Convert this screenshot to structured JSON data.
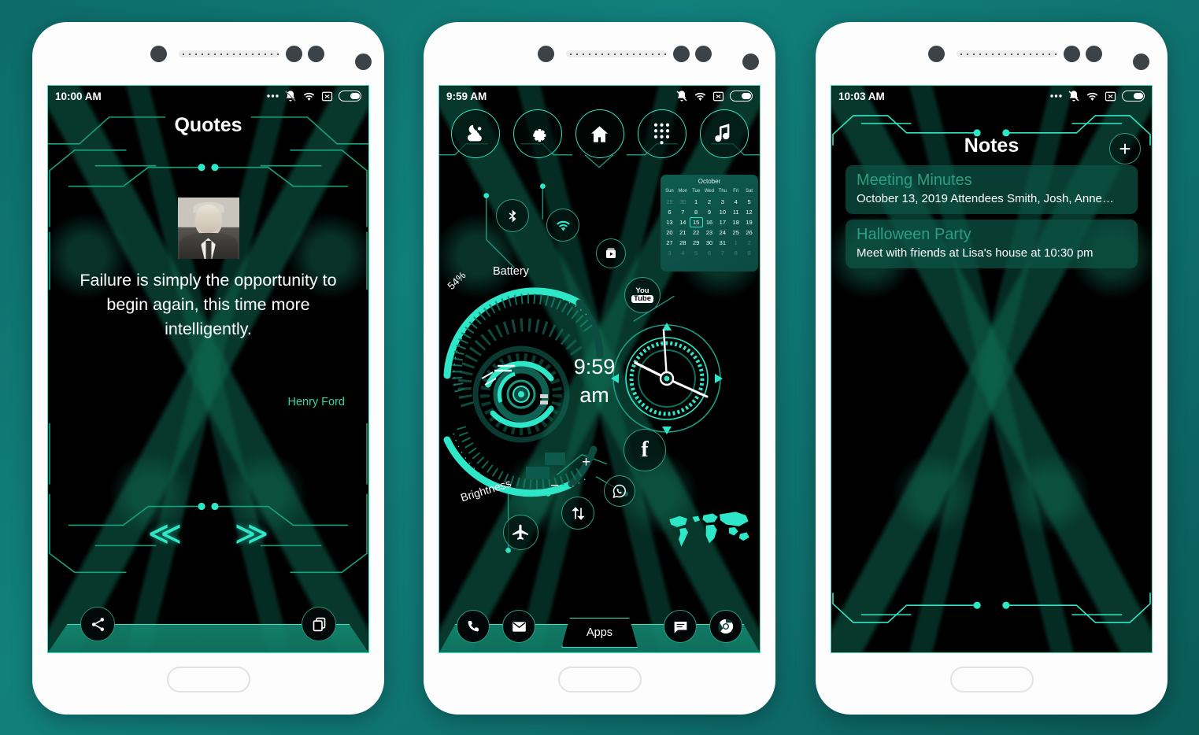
{
  "theme": {
    "page_background": "#0e7370",
    "accent_cyan": "#2ee6c8",
    "accent_green": "#2fd6a8",
    "screen_background": "#000000",
    "note_card_background": "#0c5448",
    "dock_green": "#148e76"
  },
  "phones": [
    {
      "id": "quotes",
      "status_bar": {
        "time": "10:00 AM",
        "icons": [
          "more-dots-icon",
          "bell-muted-icon",
          "wifi-icon",
          "no-sim-icon",
          "battery-icon"
        ]
      },
      "screen": {
        "title": "Quotes",
        "portrait_alt": "Henry Ford portrait",
        "quote_text": "Failure is simply the opportunity to begin again, this time more intelligently.",
        "author": "Henry Ford",
        "prev_label": "≪",
        "next_label": "≫",
        "share_icon": "share-icon",
        "copy_icon": "copy-icon"
      }
    },
    {
      "id": "home",
      "status_bar": {
        "time": "9:59 AM",
        "icons": [
          "bell-muted-icon",
          "wifi-icon",
          "no-sim-icon",
          "battery-icon"
        ]
      },
      "screen": {
        "top_icons": [
          {
            "name": "weather-icon",
            "label": "Weather"
          },
          {
            "name": "settings-gear-icon",
            "label": "Settings"
          },
          {
            "name": "home-icon",
            "label": "Home"
          },
          {
            "name": "dialpad-icon",
            "label": "Dialpad"
          },
          {
            "name": "music-note-icon",
            "label": "Music"
          }
        ],
        "calendar": {
          "month": "October",
          "day_headers": [
            "Sun",
            "Mon",
            "Tue",
            "Wed",
            "Thu",
            "Fri",
            "Sat"
          ],
          "weeks": [
            [
              "29",
              "30",
              "1",
              "2",
              "3",
              "4",
              "5"
            ],
            [
              "6",
              "7",
              "8",
              "9",
              "10",
              "11",
              "12"
            ],
            [
              "13",
              "14",
              "15",
              "16",
              "17",
              "18",
              "19"
            ],
            [
              "20",
              "21",
              "22",
              "23",
              "24",
              "25",
              "26"
            ],
            [
              "27",
              "28",
              "29",
              "30",
              "31",
              "1",
              "2"
            ],
            [
              "3",
              "4",
              "5",
              "6",
              "7",
              "8",
              "9"
            ]
          ],
          "today": "15",
          "leading_muted": 2,
          "trailing_muted_from": "2019-11-01"
        },
        "toggles": [
          {
            "name": "bluetooth-toggle",
            "state": "off"
          },
          {
            "name": "wifi-toggle",
            "state": "on"
          },
          {
            "name": "airplane-mode-toggle",
            "state": "off"
          },
          {
            "name": "data-sync-toggle",
            "state": "off"
          }
        ],
        "battery_gauge": {
          "label": "Battery",
          "value": "54%",
          "percent": 54
        },
        "brightness_gauge": {
          "label": "Brightness",
          "increase": "+",
          "decrease": "−",
          "percent": 64
        },
        "digital_clock": {
          "time": "9:59",
          "meridiem": "am"
        },
        "analog_clock": {
          "hour": 9,
          "minute": 59
        },
        "shortcuts": [
          {
            "name": "play-store-icon",
            "label": "Play Store"
          },
          {
            "name": "youtube-icon",
            "label_top": "You",
            "label_bottom": "Tube"
          },
          {
            "name": "facebook-icon",
            "label": "f"
          },
          {
            "name": "whatsapp-icon",
            "label": "WhatsApp"
          }
        ],
        "world_map_label": "World map",
        "dock": [
          {
            "name": "dock-phone",
            "icon": "phone-icon"
          },
          {
            "name": "dock-mail",
            "icon": "envelope-icon"
          },
          {
            "name": "dock-apps",
            "label": "Apps"
          },
          {
            "name": "dock-messages",
            "icon": "message-icon"
          },
          {
            "name": "dock-chrome",
            "icon": "chrome-icon"
          }
        ]
      }
    },
    {
      "id": "notes",
      "status_bar": {
        "time": "10:03 AM",
        "icons": [
          "more-dots-icon",
          "bell-muted-icon",
          "wifi-icon",
          "no-sim-icon",
          "battery-icon"
        ]
      },
      "screen": {
        "title": "Notes",
        "add_label": "+",
        "notes": [
          {
            "title": "Meeting Minutes",
            "body": "October 13, 2019 Attendees Smith, Josh, Anne…"
          },
          {
            "title": "Halloween Party",
            "body": "Meet with friends at Lisa's house at 10:30 pm"
          }
        ]
      }
    }
  ]
}
